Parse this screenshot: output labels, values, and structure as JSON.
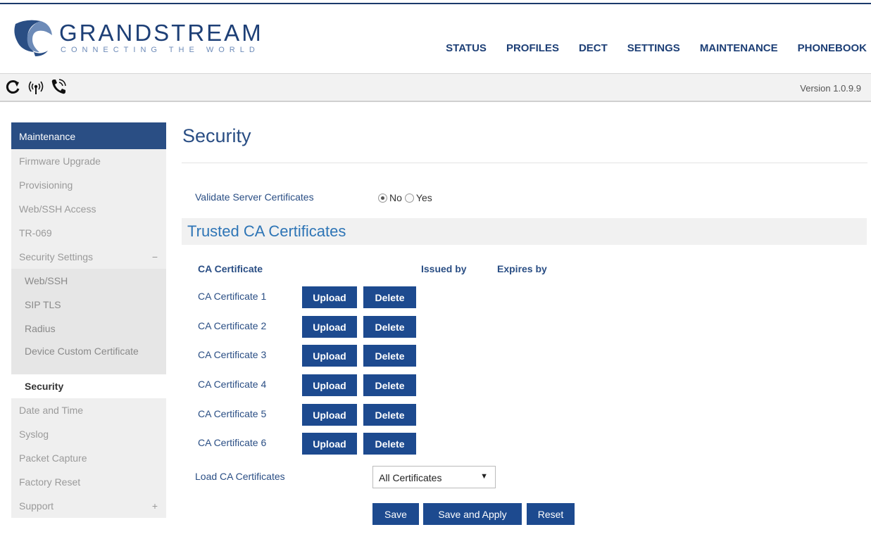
{
  "header": {
    "brand_name": "GRANDSTREAM",
    "brand_tagline": "CONNECTING THE WORLD",
    "brand_color": "#1d3f76",
    "nav": [
      "STATUS",
      "PROFILES",
      "DECT",
      "SETTINGS",
      "MAINTENANCE",
      "PHONEBOOK"
    ]
  },
  "toolbar": {
    "icons": [
      "refresh-icon",
      "wireless-signal-icon",
      "phone-ringing-icon"
    ],
    "version": "Version 1.0.9.9"
  },
  "sidebar": {
    "header": "Maintenance",
    "items": [
      {
        "label": "Firmware Upgrade"
      },
      {
        "label": "Provisioning"
      },
      {
        "label": "Web/SSH Access"
      },
      {
        "label": "TR-069"
      },
      {
        "label": "Security Settings",
        "toggle": "−"
      },
      {
        "label": "Web/SSH"
      },
      {
        "label": "SIP TLS"
      },
      {
        "label": "Radius"
      },
      {
        "label": "Device Custom Certificate"
      },
      {
        "label": "Security"
      },
      {
        "label": "Date and Time"
      },
      {
        "label": "Syslog"
      },
      {
        "label": "Packet Capture"
      },
      {
        "label": "Factory Reset"
      },
      {
        "label": "Support",
        "toggle": "+"
      }
    ]
  },
  "main": {
    "title": "Security",
    "validate": {
      "label": "Validate Server Certificates",
      "options": [
        "No",
        "Yes"
      ],
      "selected": "No"
    },
    "section_title": "Trusted CA Certificates",
    "columns": [
      "CA Certificate",
      "Issued by",
      "Expires by"
    ],
    "certificates": [
      {
        "label": "CA Certificate 1",
        "upload": "Upload",
        "delete": "Delete"
      },
      {
        "label": "CA Certificate 2",
        "upload": "Upload",
        "delete": "Delete"
      },
      {
        "label": "CA Certificate 3",
        "upload": "Upload",
        "delete": "Delete"
      },
      {
        "label": "CA Certificate 4",
        "upload": "Upload",
        "delete": "Delete"
      },
      {
        "label": "CA Certificate 5",
        "upload": "Upload",
        "delete": "Delete"
      },
      {
        "label": "CA Certificate 6",
        "upload": "Upload",
        "delete": "Delete"
      }
    ],
    "load": {
      "label": "Load CA Certificates",
      "value": "All Certificates"
    },
    "actions": {
      "save": "Save",
      "save_apply": "Save and Apply",
      "reset": "Reset"
    }
  }
}
